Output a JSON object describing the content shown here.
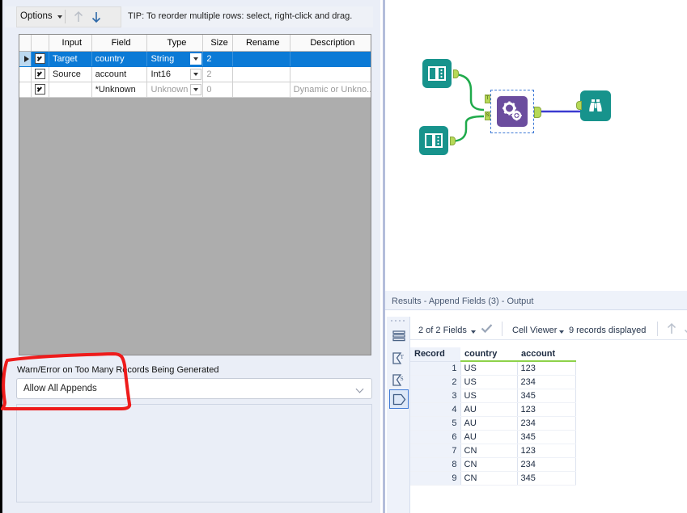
{
  "config_panel": {
    "toolbar": {
      "options_label": "Options",
      "move_up_icon": "arrow-up-icon",
      "move_down_icon": "arrow-down-icon",
      "tip_text": "TIP: To reorder multiple rows: select, right-click and drag."
    },
    "grid": {
      "columns": [
        "Input",
        "Field",
        "Type",
        "Size",
        "Rename",
        "Description"
      ],
      "rows": [
        {
          "selected": true,
          "marker": true,
          "checked": true,
          "input": "Target",
          "field": "country",
          "type": "String",
          "size": "2",
          "rename": "",
          "description": "",
          "dim": false
        },
        {
          "selected": false,
          "marker": false,
          "checked": true,
          "input": "Source",
          "field": "account",
          "type": "Int16",
          "size": "2",
          "rename": "",
          "description": "",
          "dim": false
        },
        {
          "selected": false,
          "marker": false,
          "checked": true,
          "input": "",
          "field": "*Unknown",
          "type": "Unknown",
          "size": "0",
          "rename": "",
          "description": "Dynamic or Unkno...",
          "dim": true
        }
      ]
    },
    "option": {
      "label": "Warn/Error on Too Many Records Being Generated",
      "value": "Allow All Appends",
      "chevron_icon": "chevron-down-icon"
    },
    "annotation": {
      "shape": "red-hand-drawn-rectangle",
      "color": "#ee1b1b"
    }
  },
  "canvas": {
    "nodes": [
      {
        "name": "input-data-tool-top",
        "icon": "input-data-icon",
        "color": "#17938c"
      },
      {
        "name": "input-data-tool-bottom",
        "icon": "input-data-icon",
        "color": "#17938c"
      },
      {
        "name": "append-fields-tool",
        "icon": "append-fields-gears-icon",
        "color": "#6b4d9e",
        "selected": true,
        "input_anchors": [
          "T",
          "S"
        ]
      },
      {
        "name": "browse-tool",
        "icon": "binoculars-icon",
        "color": "#17938c"
      }
    ],
    "connection_colors": {
      "data": "#1faa4b",
      "output": "#3a3ad0"
    }
  },
  "results": {
    "title": "Results - Append Fields (3) - Output",
    "side_icons": [
      "records-list-icon",
      "sigma-t-icon",
      "sigma-s-icon",
      "tag-output-icon"
    ],
    "selected_side_icon_index": 3,
    "toolbar": {
      "fields_label": "2 of 2 Fields",
      "fields_caret_icon": "chevron-down-icon",
      "check_icon": "checkmark-icon",
      "viewer_label": "Cell Viewer",
      "viewer_caret_icon": "chevron-down-icon",
      "records_label": "9 records displayed",
      "up_icon": "arrow-up-icon",
      "down_icon": "arrow-down-icon"
    },
    "table": {
      "columns": [
        "Record",
        "country",
        "account"
      ],
      "rows": [
        {
          "record": "1",
          "country": "US",
          "account": "123"
        },
        {
          "record": "2",
          "country": "US",
          "account": "234"
        },
        {
          "record": "3",
          "country": "US",
          "account": "345"
        },
        {
          "record": "4",
          "country": "AU",
          "account": "123"
        },
        {
          "record": "5",
          "country": "AU",
          "account": "234"
        },
        {
          "record": "6",
          "country": "AU",
          "account": "345"
        },
        {
          "record": "7",
          "country": "CN",
          "account": "123"
        },
        {
          "record": "8",
          "country": "CN",
          "account": "234"
        },
        {
          "record": "9",
          "country": "CN",
          "account": "345"
        }
      ]
    }
  }
}
